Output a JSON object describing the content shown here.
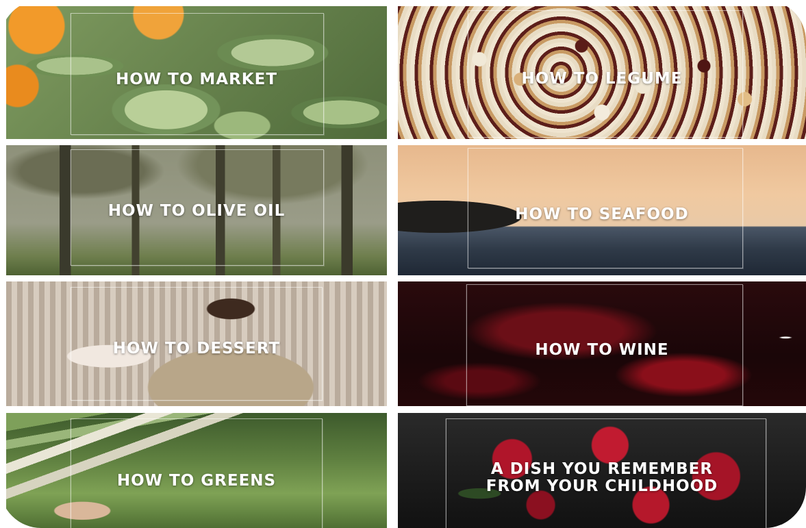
{
  "tiles": [
    {
      "id": "market",
      "label": "HOW TO MARKET"
    },
    {
      "id": "legume",
      "label": "HOW TO LEGUME"
    },
    {
      "id": "olive",
      "label": "HOW TO OLIVE OIL"
    },
    {
      "id": "seafood",
      "label": "HOW TO SEAFOOD"
    },
    {
      "id": "dessert",
      "label": "HOW TO DESSERT"
    },
    {
      "id": "wine",
      "label": "HOW TO WINE"
    },
    {
      "id": "greens",
      "label": "HOW TO GREENS"
    },
    {
      "id": "childhood",
      "label": "A DISH YOU REMEMBER\nFROM YOUR CHILDHOOD"
    }
  ]
}
